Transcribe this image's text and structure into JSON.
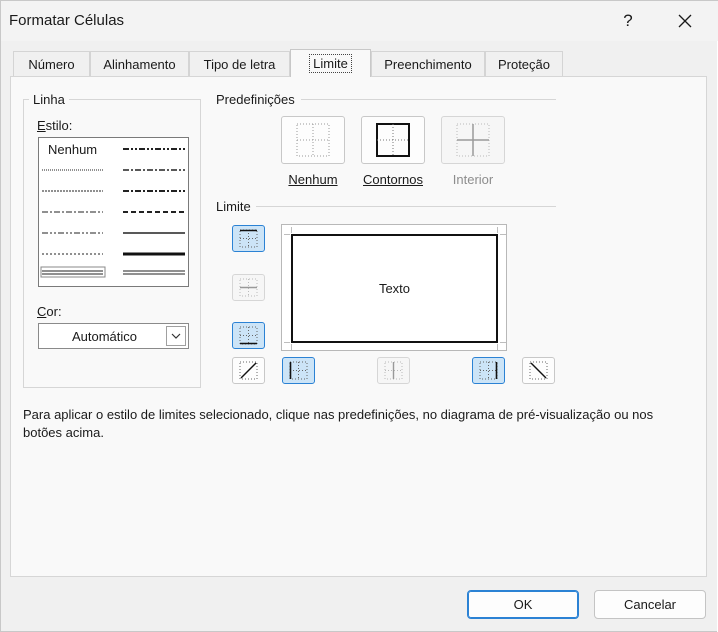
{
  "window": {
    "title": "Formatar Células",
    "help_glyph": "?",
    "close_glyph": "✕"
  },
  "tabs": [
    {
      "label": "Número",
      "active": false
    },
    {
      "label": "Alinhamento",
      "active": false
    },
    {
      "label": "Tipo de letra",
      "active": false
    },
    {
      "label": "Limite",
      "active": true
    },
    {
      "label": "Preenchimento",
      "active": false
    },
    {
      "label": "Proteção",
      "active": false
    }
  ],
  "line": {
    "group_title": "Linha",
    "style_label": "Estilo:",
    "style_none": "Nenhum",
    "color_label": "Cor:",
    "color_value": "Automático"
  },
  "presets": {
    "title": "Predefinições",
    "items": [
      {
        "label": "Nenhum",
        "icon": "border-none-icon",
        "enabled": true
      },
      {
        "label": "Contornos",
        "icon": "border-outline-icon",
        "enabled": true
      },
      {
        "label": "Interior",
        "icon": "border-inside-icon",
        "enabled": false
      }
    ]
  },
  "border": {
    "title": "Limite",
    "preview_text": "Texto",
    "buttons": [
      {
        "name": "border-top-button",
        "state": "on"
      },
      {
        "name": "border-inside-horizontal-button",
        "state": "off"
      },
      {
        "name": "border-bottom-button",
        "state": "on"
      },
      {
        "name": "border-diagonal-up-button",
        "state": "normal"
      },
      {
        "name": "border-left-button",
        "state": "on"
      },
      {
        "name": "border-inside-vertical-button",
        "state": "off"
      },
      {
        "name": "border-right-button",
        "state": "on"
      },
      {
        "name": "border-diagonal-down-button",
        "state": "normal"
      }
    ]
  },
  "help_text": "Para aplicar o estilo de limites selecionado, clique nas predefinições, no diagrama de pré-visualização ou nos botões acima.",
  "actions": {
    "ok": "OK",
    "cancel": "Cancelar"
  },
  "colors": {
    "accent": "#2b82d4",
    "selected_fill": "#cce4f7"
  }
}
